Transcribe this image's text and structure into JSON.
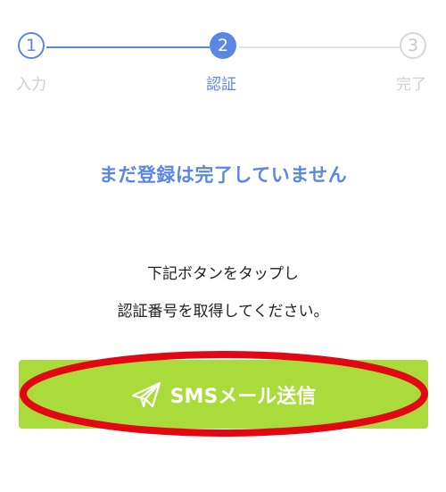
{
  "stepper": {
    "steps": [
      {
        "number": "1",
        "label": "入力"
      },
      {
        "number": "2",
        "label": "認証"
      },
      {
        "number": "3",
        "label": "完了"
      }
    ],
    "current_step": 2
  },
  "notice": "まだ登録は完了していません",
  "instructions": {
    "line1": "下記ボタンをタップし",
    "line2": "認証番号を取得してください。"
  },
  "sms_button": {
    "label": "SMSメール送信",
    "icon": "paper-plane-icon"
  },
  "colors": {
    "accent": "#5a86e6",
    "button": "#a9dc3a",
    "highlight": "#e30613",
    "inactive": "#cfcfcf"
  }
}
